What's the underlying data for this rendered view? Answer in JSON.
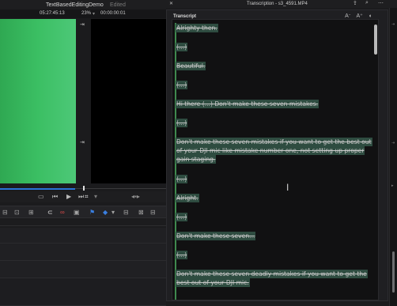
{
  "editor": {
    "project_name": "TextBasedEditingDemo",
    "project_status": "Edited",
    "source_timecode": "05:27:45:13",
    "zoom_level": "23%",
    "record_timecode": "00:00:00:01"
  },
  "transcript_window": {
    "title": "Transcription - s3_4591.MP4",
    "panel_label": "Transcript",
    "tool_icons": [
      "decrease-font-icon",
      "increase-font-icon",
      "options-icon"
    ]
  },
  "transcript": {
    "paragraphs": [
      "Alrighty then.",
      "(...)",
      "Beautiful.",
      "(...)",
      "Hi there (...) Don't make these seven mistakes.",
      "(...)",
      "Don't make these seven mistakes if you want to get the best out of your DJI mic like mistake number one, not setting up proper gain staging.",
      "(...)",
      "Alright.",
      "(...)",
      "Don't make these seven...",
      "(...)",
      "Don't make these seven deadly mistakes if you want to get the best out of your DJI mic."
    ]
  },
  "colors": {
    "green_screen": "#3bbf63",
    "selection_highlight": "#2e4c40",
    "accent_blue": "#2a73d6"
  }
}
